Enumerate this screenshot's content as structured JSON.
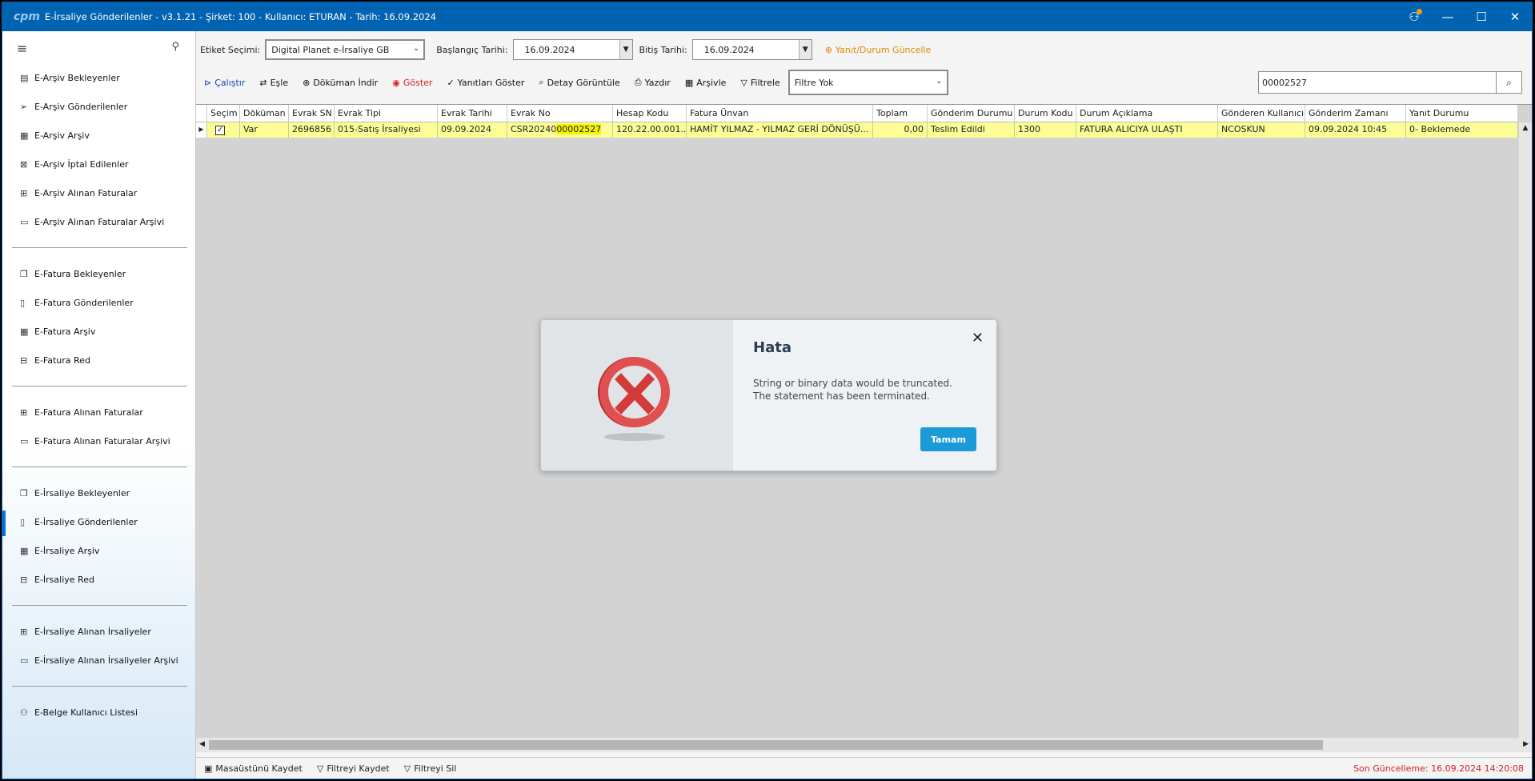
{
  "window": {
    "logo": "cpm",
    "title": "E-İrsaliye Gönderilenler - v3.1.21 - Şirket: 100 - Kullanıcı: ETURAN - Tarih: 16.09.2024"
  },
  "sidebar": {
    "items": [
      {
        "label": "E-Arşiv Bekleyenler",
        "icon": "document-list-icon"
      },
      {
        "label": "E-Arşiv Gönderilenler",
        "icon": "send-icon"
      },
      {
        "label": "E-Arşiv Arşiv",
        "icon": "archive-icon"
      },
      {
        "label": "E-Arşiv İptal Edilenler",
        "icon": "cancel-document-icon"
      },
      {
        "label": "E-Arşiv Alınan Faturalar",
        "icon": "inbox-icon"
      },
      {
        "label": "E-Arşiv Alınan Faturalar Arşivi",
        "icon": "folder-icon"
      },
      {
        "label": "E-Fatura Bekleyenler",
        "icon": "documents-icon"
      },
      {
        "label": "E-Fatura Gönderilenler",
        "icon": "document-icon"
      },
      {
        "label": "E-Fatura Arşiv",
        "icon": "archive-icon"
      },
      {
        "label": "E-Fatura Red",
        "icon": "reject-icon"
      },
      {
        "label": "E-Fatura Alınan Faturalar",
        "icon": "inbox-icon"
      },
      {
        "label": "E-Fatura Alınan Faturalar Arşivi",
        "icon": "folder-icon"
      },
      {
        "label": "E-İrsaliye Bekleyenler",
        "icon": "documents-icon"
      },
      {
        "label": "E-İrsaliye Gönderilenler",
        "icon": "document-icon"
      },
      {
        "label": "E-İrsaliye Arşiv",
        "icon": "archive-icon"
      },
      {
        "label": "E-İrsaliye Red",
        "icon": "reject-icon"
      },
      {
        "label": "E-İrsaliye Alınan İrsaliyeler",
        "icon": "inbox-icon"
      },
      {
        "label": "E-İrsaliye Alınan İrsaliyeler Arşivi",
        "icon": "folder-icon"
      },
      {
        "label": "E-Belge Kullanıcı Listesi",
        "icon": "users-icon"
      }
    ]
  },
  "filters": {
    "etiket_label": "Etiket Seçimi:",
    "etiket_value": "Digital Planet e-İrsaliye GB",
    "baslangic_label": "Başlangıç Tarihi:",
    "baslangic_value": "16.09.2024",
    "bitis_label": "Bitiş Tarihi:",
    "bitis_value": "16.09.2024",
    "update_link": "Yanıt/Durum Güncelle"
  },
  "toolbar": {
    "calistir": "Çalıştır",
    "esle": "Eşle",
    "dokuman_indir": "Döküman İndir",
    "goster": "Göster",
    "yanitlari_goster": "Yanıtları Göster",
    "detay": "Detay Görüntüle",
    "yazdir": "Yazdır",
    "arsivle": "Arşivle",
    "filtrele": "Filtrele",
    "filter_select": "Filtre Yok",
    "search_value": "00002527"
  },
  "grid": {
    "columns": [
      "Seçim",
      "Döküman",
      "Evrak SN",
      "Evrak Tipi",
      "Evrak Tarihi",
      "Evrak No",
      "Hesap Kodu",
      "Fatura Ünvan",
      "Toplam",
      "Gönderim Durumu",
      "Durum Kodu",
      "Durum Açıklama",
      "Gönderen Kullanıcı",
      "Gönderim Zamanı",
      "Yanıt Durumu"
    ],
    "row": {
      "dokuman": "Var",
      "evrak_sn": "2696856",
      "evrak_tipi": "015-Satış İrsaliyesi",
      "evrak_tarihi": "09.09.2024",
      "evrak_no_prefix": "CSR20240",
      "evrak_no_match": "00002527",
      "hesap_kodu": "120.22.00.001...",
      "fatura_unvan": "HAMİT YILMAZ - YILMAZ GERİ DÖNÜŞÜ...",
      "toplam": "0,00",
      "gonderim_durumu": "Teslim Edildi",
      "durum_kodu": "1300",
      "durum_aciklama": "FATURA ALICIYA ULAŞTI",
      "gonderen": "NCOSKUN",
      "gonderim_zamani": "09.09.2024 10:45",
      "yanit_durumu": "0- Beklemede"
    }
  },
  "statusbar": {
    "masaustu": "Masaüstünü Kaydet",
    "filtre_kaydet": "Filtreyi Kaydet",
    "filtre_sil": "Filtreyi Sil",
    "last_update": "Son Güncelleme: 16.09.2024 14:20:08"
  },
  "dialog": {
    "title": "Hata",
    "message_line1": "String or binary data would be truncated.",
    "message_line2": "The statement has been terminated.",
    "ok_label": "Tamam"
  },
  "colors": {
    "titlebar": "#0063b1",
    "row_highlight": "#fdfd96",
    "match_highlight": "#f5f500",
    "accent_orange": "#e08a00",
    "ok_button": "#1a9ad6"
  }
}
